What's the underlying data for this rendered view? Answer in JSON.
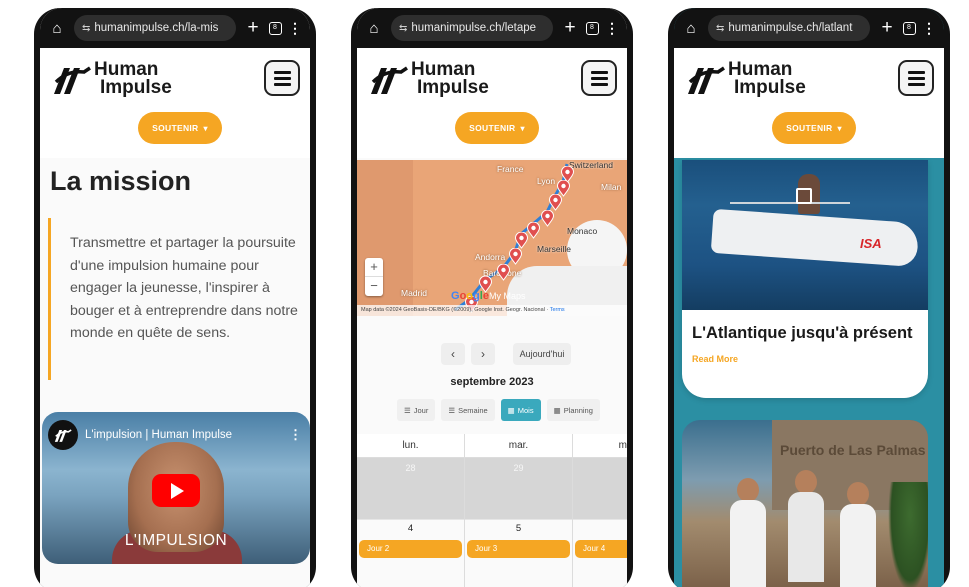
{
  "phones": [
    {
      "url": "humanimpulse.ch/la-mis",
      "tab_count": "8",
      "logo": {
        "line1": "Human",
        "line2": "Impulse"
      },
      "cta": "SOUTENIR",
      "page_title": "La mission",
      "quote": "Transmettre et partager la poursuite d'une impulsion humaine pour engager la jeunesse, l'inspirer à bouger et à entreprendre dans notre monde en quête de sens.",
      "video": {
        "title": "L'impulsion | Human Impulse",
        "caption": "L'IMPULSION"
      }
    },
    {
      "url": "humanimpulse.ch/letape",
      "tab_count": "8",
      "logo": {
        "line1": "Human",
        "line2": "Impulse"
      },
      "cta": "SOUTENIR",
      "map": {
        "labels": [
          "France",
          "Switzerland",
          "Lyon",
          "Milan",
          "Monaco",
          "Marseille",
          "Andorra",
          "Barcelone",
          "Madrid"
        ],
        "zoom_in": "+",
        "zoom_out": "−",
        "brand": "Google",
        "product": "My Maps",
        "footer": "Map data ©2024 GeoBasis-DE/BKG (©2009), Google Inst. Geogr. Nacional",
        "terms": "Terms"
      },
      "calendar": {
        "prev": "‹",
        "next": "›",
        "today": "Aujourd'hui",
        "month": "septembre 2023",
        "views": [
          "Jour",
          "Semaine",
          "Mois",
          "Planning"
        ],
        "active_view": "Mois",
        "columns": [
          {
            "head": "lun.",
            "prev_day": "28",
            "day": "4",
            "event": "Jour 2"
          },
          {
            "head": "mar.",
            "prev_day": "29",
            "day": "5",
            "event": "Jour 3"
          },
          {
            "head": "m",
            "prev_day": "",
            "day": "",
            "event": "Jour 4"
          }
        ]
      }
    },
    {
      "url": "humanimpulse.ch/latlant",
      "tab_count": "8",
      "logo": {
        "line1": "Human",
        "line2": "Impulse"
      },
      "cta": "SOUTENIR",
      "article": {
        "title": "L'Atlantique jusqu'à présent",
        "read_more": "Read More",
        "boat_label": "ISA"
      },
      "article2": {
        "sign": "Puerto de Las Palmas"
      }
    }
  ],
  "colors": {
    "accent": "#f5a623",
    "calendar_active": "#3aa9bd",
    "dark": "#121212"
  },
  "icons": [
    "home-icon",
    "site-settings-icon",
    "new-tab-icon",
    "tabs-icon",
    "overflow-menu-icon",
    "hamburger-icon",
    "chevron-down-icon",
    "play-icon",
    "external-link-icon",
    "map-pin-icon",
    "list-icon",
    "calendar-icon"
  ]
}
